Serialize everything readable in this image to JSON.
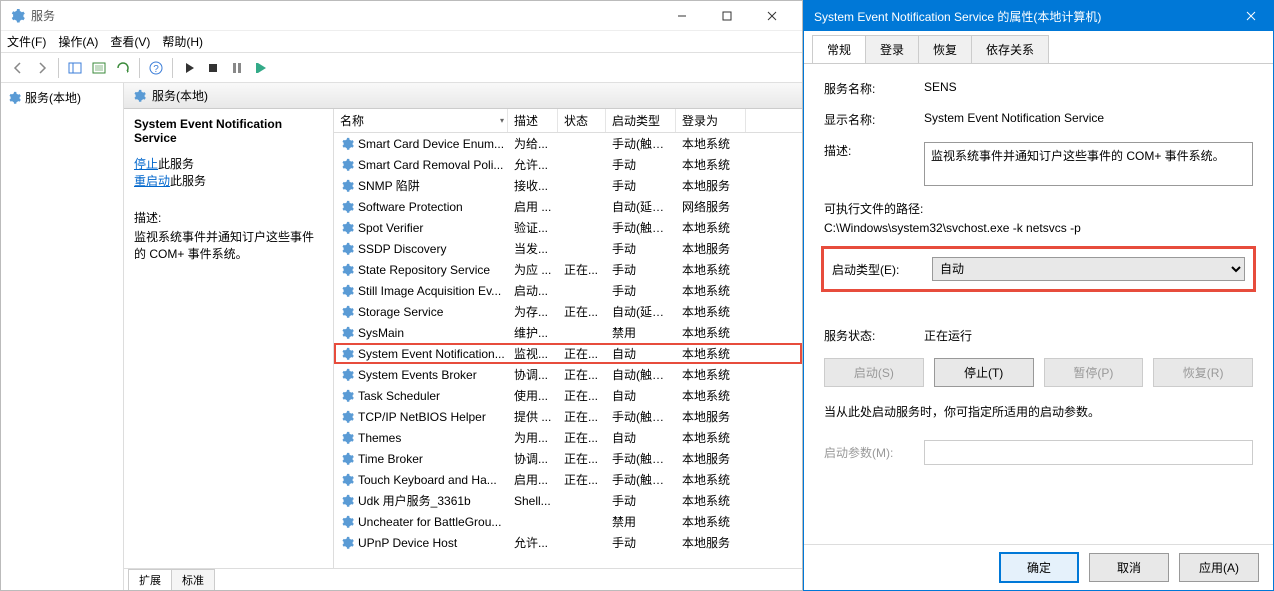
{
  "main_window": {
    "title": "服务",
    "menubar": [
      "文件(F)",
      "操作(A)",
      "查看(V)",
      "帮助(H)"
    ],
    "tree_root": "服务(本地)",
    "content_header": "服务(本地)",
    "detail": {
      "service_name": "System Event Notification Service",
      "stop_link": "停止",
      "stop_suffix": "此服务",
      "restart_link": "重启动",
      "restart_suffix": "此服务",
      "desc_label": "描述:",
      "description": "监视系统事件并通知订户这些事件的 COM+ 事件系统。"
    },
    "columns": {
      "name": "名称",
      "desc": "描述",
      "status": "状态",
      "startup": "启动类型",
      "logon": "登录为"
    },
    "rows": [
      {
        "name": "Smart Card Device Enum...",
        "desc": "为给...",
        "status": "",
        "startup": "手动(触发...",
        "logon": "本地系统"
      },
      {
        "name": "Smart Card Removal Poli...",
        "desc": "允许...",
        "status": "",
        "startup": "手动",
        "logon": "本地系统"
      },
      {
        "name": "SNMP 陷阱",
        "desc": "接收...",
        "status": "",
        "startup": "手动",
        "logon": "本地服务"
      },
      {
        "name": "Software Protection",
        "desc": "启用 ...",
        "status": "",
        "startup": "自动(延迟...",
        "logon": "网络服务"
      },
      {
        "name": "Spot Verifier",
        "desc": "验证...",
        "status": "",
        "startup": "手动(触发...",
        "logon": "本地系统"
      },
      {
        "name": "SSDP Discovery",
        "desc": "当发...",
        "status": "",
        "startup": "手动",
        "logon": "本地服务"
      },
      {
        "name": "State Repository Service",
        "desc": "为应 ...",
        "status": "正在...",
        "startup": "手动",
        "logon": "本地系统"
      },
      {
        "name": "Still Image Acquisition Ev...",
        "desc": "启动...",
        "status": "",
        "startup": "手动",
        "logon": "本地系统"
      },
      {
        "name": "Storage Service",
        "desc": "为存...",
        "status": "正在...",
        "startup": "自动(延迟...",
        "logon": "本地系统"
      },
      {
        "name": "SysMain",
        "desc": "维护...",
        "status": "",
        "startup": "禁用",
        "logon": "本地系统"
      },
      {
        "name": "System Event Notification...",
        "desc": "监视...",
        "status": "正在...",
        "startup": "自动",
        "logon": "本地系统",
        "selected": true
      },
      {
        "name": "System Events Broker",
        "desc": "协调...",
        "status": "正在...",
        "startup": "自动(触发...",
        "logon": "本地系统"
      },
      {
        "name": "Task Scheduler",
        "desc": "使用...",
        "status": "正在...",
        "startup": "自动",
        "logon": "本地系统"
      },
      {
        "name": "TCP/IP NetBIOS Helper",
        "desc": "提供 ...",
        "status": "正在...",
        "startup": "手动(触发...",
        "logon": "本地服务"
      },
      {
        "name": "Themes",
        "desc": "为用...",
        "status": "正在...",
        "startup": "自动",
        "logon": "本地系统"
      },
      {
        "name": "Time Broker",
        "desc": "协调...",
        "status": "正在...",
        "startup": "手动(触发...",
        "logon": "本地服务"
      },
      {
        "name": "Touch Keyboard and Ha...",
        "desc": "启用...",
        "status": "正在...",
        "startup": "手动(触发...",
        "logon": "本地系统"
      },
      {
        "name": "Udk 用户服务_3361b",
        "desc": "Shell...",
        "status": "",
        "startup": "手动",
        "logon": "本地系统"
      },
      {
        "name": "Uncheater for BattleGrou...",
        "desc": "",
        "status": "",
        "startup": "禁用",
        "logon": "本地系统"
      },
      {
        "name": "UPnP Device Host",
        "desc": "允许...",
        "status": "",
        "startup": "手动",
        "logon": "本地服务"
      }
    ],
    "bottom_tabs": {
      "extended": "扩展",
      "standard": "标准"
    }
  },
  "dialog": {
    "title": "System Event Notification Service 的属性(本地计算机)",
    "tabs": [
      "常规",
      "登录",
      "恢复",
      "依存关系"
    ],
    "svc_name_label": "服务名称:",
    "svc_name": "SENS",
    "disp_name_label": "显示名称:",
    "disp_name": "System Event Notification Service",
    "desc_label": "描述:",
    "desc": "监视系统事件并通知订户这些事件的 COM+ 事件系统。",
    "exe_label": "可执行文件的路径:",
    "exe_path": "C:\\Windows\\system32\\svchost.exe -k netsvcs -p",
    "startup_label": "启动类型(E):",
    "startup_value": "自动",
    "status_label": "服务状态:",
    "status_value": "正在运行",
    "buttons": {
      "start": "启动(S)",
      "stop": "停止(T)",
      "pause": "暂停(P)",
      "resume": "恢复(R)"
    },
    "hint": "当从此处启动服务时，你可指定所适用的启动参数。",
    "param_label": "启动参数(M):",
    "dlg_buttons": {
      "ok": "确定",
      "cancel": "取消",
      "apply": "应用(A)"
    }
  }
}
